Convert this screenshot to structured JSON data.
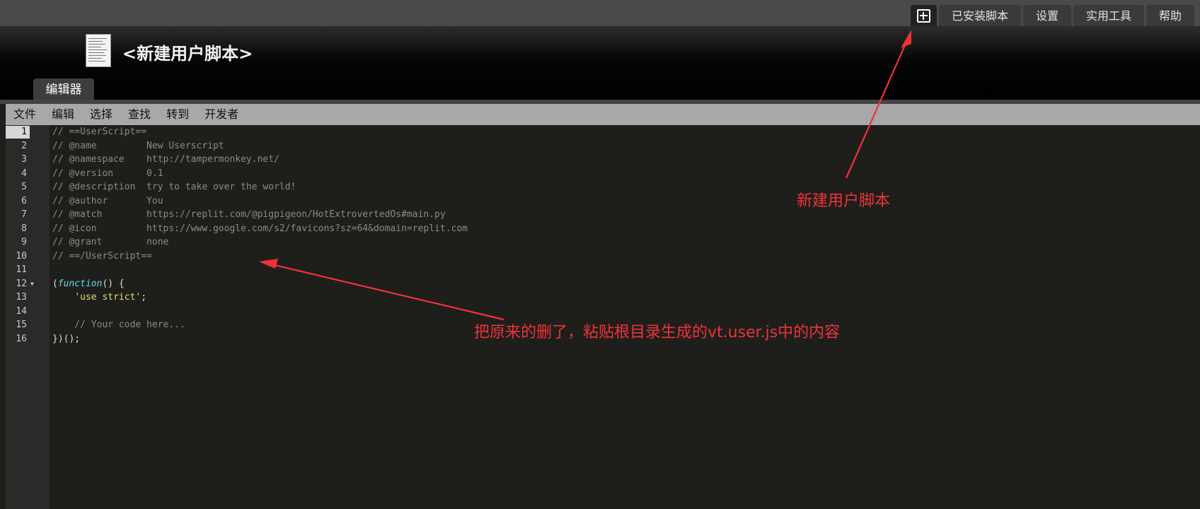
{
  "nav": {
    "new_icon": "plus-square-icon",
    "tabs": [
      "已安装脚本",
      "设置",
      "实用工具",
      "帮助"
    ]
  },
  "header": {
    "title": "<新建用户脚本>",
    "editor_tab": "编辑器"
  },
  "menu": [
    "文件",
    "编辑",
    "选择",
    "查找",
    "转到",
    "开发者"
  ],
  "editor": {
    "lines": [
      "// ==UserScript==",
      "// @name         New Userscript",
      "// @namespace    http://tampermonkey.net/",
      "// @version      0.1",
      "// @description  try to take over the world!",
      "// @author       You",
      "// @match        https://replit.com/@pigpigeon/HotExtrovertedOs#main.py",
      "// @icon         https://www.google.com/s2/favicons?sz=64&domain=replit.com",
      "// @grant        none",
      "// ==/UserScript==",
      "",
      "(function() {",
      "    'use strict';",
      "",
      "    // Your code here...",
      "})();"
    ],
    "active_line": 1
  },
  "annotations": {
    "new_script": "新建用户脚本",
    "instruction": "把原来的删了，粘贴根目录生成的vt.user.js中的内容",
    "color": "#f2313a"
  }
}
